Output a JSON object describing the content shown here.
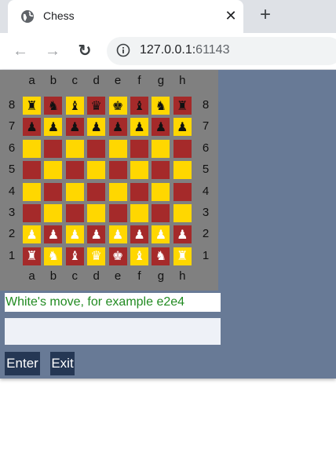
{
  "browser": {
    "tab_title": "Chess",
    "tab_close_glyph": "✕",
    "new_tab_glyph": "+",
    "back_glyph": "←",
    "forward_glyph": "→",
    "reload_glyph": "↻",
    "url_host": "127.0.0.1:",
    "url_port": "61143"
  },
  "board": {
    "files": [
      "a",
      "b",
      "c",
      "d",
      "e",
      "f",
      "g",
      "h"
    ],
    "ranks": [
      "8",
      "7",
      "6",
      "5",
      "4",
      "3",
      "2",
      "1"
    ],
    "rows": [
      [
        "♜",
        "♞",
        "♝",
        "♛",
        "♚",
        "♝",
        "♞",
        "♜"
      ],
      [
        "♟",
        "♟",
        "♟",
        "♟",
        "♟",
        "♟",
        "♟",
        "♟"
      ],
      [
        "",
        "",
        "",
        "",
        "",
        "",
        "",
        ""
      ],
      [
        "",
        "",
        "",
        "",
        "",
        "",
        "",
        ""
      ],
      [
        "",
        "",
        "",
        "",
        "",
        "",
        "",
        ""
      ],
      [
        "",
        "",
        "",
        "",
        "",
        "",
        "",
        ""
      ],
      [
        "♟",
        "♟",
        "♟",
        "♟",
        "♟",
        "♟",
        "♟",
        "♟"
      ],
      [
        "♜",
        "♞",
        "♝",
        "♛",
        "♚",
        "♝",
        "♞",
        "♜"
      ]
    ],
    "row_colors": [
      "black",
      "black",
      "",
      "",
      "",
      "",
      "white",
      "white"
    ],
    "light_color": "#ffd700",
    "dark_color": "#a52a2a"
  },
  "status": {
    "text": "White's move, for example e2e4",
    "color": "#228b22"
  },
  "input": {
    "value": "",
    "placeholder": ""
  },
  "buttons": {
    "enter_label": "Enter",
    "exit_label": "Exit"
  },
  "colors": {
    "page_background": "#687a96",
    "board_frame": "#808080",
    "button_background": "#253754"
  }
}
